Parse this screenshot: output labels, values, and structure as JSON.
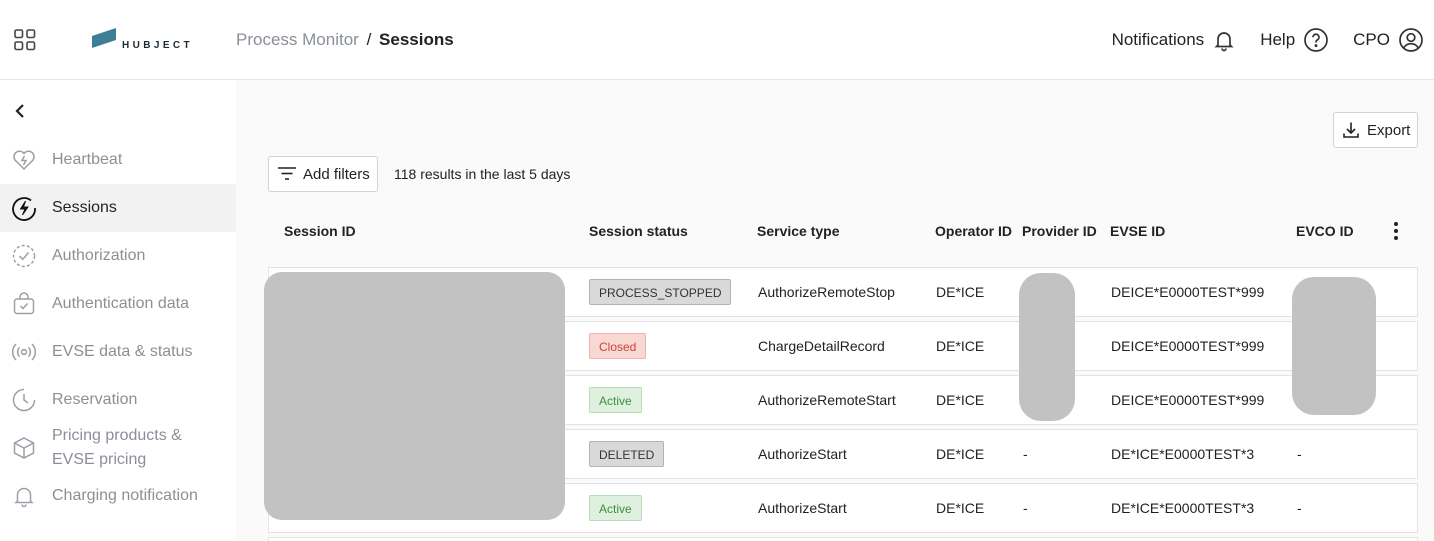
{
  "header": {
    "logo_text": "HUBJECT",
    "breadcrumb_parent": "Process Monitor",
    "breadcrumb_separator": "/",
    "breadcrumb_current": "Sessions",
    "notifications_label": "Notifications",
    "help_label": "Help",
    "user_label": "CPO"
  },
  "sidebar": {
    "items": [
      {
        "label": "Heartbeat",
        "icon": "heart-pulse-icon"
      },
      {
        "label": "Sessions",
        "icon": "lightning-circle-icon",
        "active": true
      },
      {
        "label": "Authorization",
        "icon": "check-circle-dashed-icon"
      },
      {
        "label": "Authentication data",
        "icon": "bag-check-icon"
      },
      {
        "label": "EVSE data & status",
        "icon": "broadcast-icon"
      },
      {
        "label": "Reservation",
        "icon": "clock-icon"
      },
      {
        "label": "Pricing products & EVSE pricing",
        "icon": "box-icon"
      },
      {
        "label": "Charging notification",
        "icon": "bell-icon"
      }
    ]
  },
  "toolbar": {
    "export_label": "Export",
    "add_filters_label": "Add filters",
    "results_text": "118 results in the last 5 days"
  },
  "table": {
    "columns": [
      "Session ID",
      "Session status",
      "Service type",
      "Operator ID",
      "Provider ID",
      "EVSE ID",
      "EVCO ID"
    ],
    "rows": [
      {
        "status": "PROCESS_STOPPED",
        "status_kind": "neutral",
        "service_type": "AuthorizeRemoteStop",
        "operator_id": "DE*ICE",
        "provider_id": "",
        "evse_id": "DEICE*E0000TEST*999",
        "evco_id": ""
      },
      {
        "status": "Closed",
        "status_kind": "closed",
        "service_type": "ChargeDetailRecord",
        "operator_id": "DE*ICE",
        "provider_id": "",
        "evse_id": "DEICE*E0000TEST*999",
        "evco_id": ""
      },
      {
        "status": "Active",
        "status_kind": "active",
        "service_type": "AuthorizeRemoteStart",
        "operator_id": "DE*ICE",
        "provider_id": "",
        "evse_id": "DEICE*E0000TEST*999",
        "evco_id": ""
      },
      {
        "status": "DELETED",
        "status_kind": "neutral",
        "service_type": "AuthorizeStart",
        "operator_id": "DE*ICE",
        "provider_id": "-",
        "evse_id": "DE*ICE*E0000TEST*3",
        "evco_id": "-"
      },
      {
        "status": "Active",
        "status_kind": "active",
        "service_type": "AuthorizeStart",
        "operator_id": "DE*ICE",
        "provider_id": "-",
        "evse_id": "DE*ICE*E0000TEST*3",
        "evco_id": "-"
      }
    ]
  },
  "colors": {
    "brand_logo": "#3d7f95",
    "active_nav_bg": "#f2f2f2",
    "muted_text": "#8a8f98",
    "closed_badge": "#c9443a",
    "active_badge": "#3e8e41",
    "redaction": "#c2c2c2"
  }
}
